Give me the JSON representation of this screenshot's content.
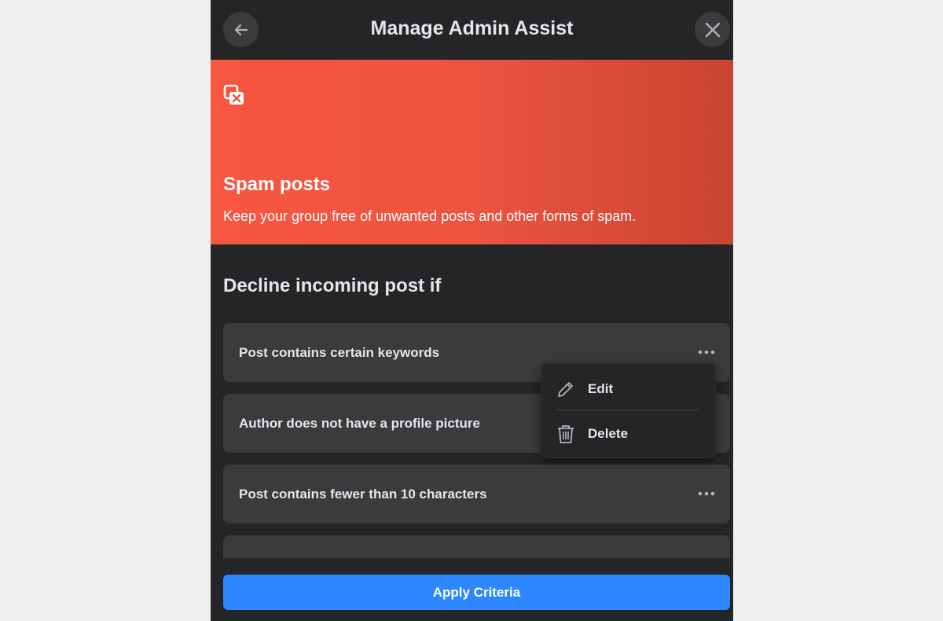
{
  "header": {
    "title": "Manage Admin Assist"
  },
  "hero": {
    "icon": "spam-icon",
    "title": "Spam posts",
    "description": "Keep your group free of unwanted posts and other forms of spam."
  },
  "section": {
    "title": "Decline incoming post if"
  },
  "rules": [
    {
      "label": "Post contains certain keywords"
    },
    {
      "label": "Author does not have a profile picture"
    },
    {
      "label": "Post contains fewer than 10 characters"
    },
    {
      "label": ""
    }
  ],
  "menu": {
    "edit_label": "Edit",
    "delete_label": "Delete"
  },
  "footer": {
    "apply_label": "Apply Criteria"
  },
  "colors": {
    "panel_bg": "#242526",
    "card_bg": "#3a3b3c",
    "accent": "#2d88ff",
    "hero_start": "#f85640",
    "hero_end": "#c94431"
  }
}
